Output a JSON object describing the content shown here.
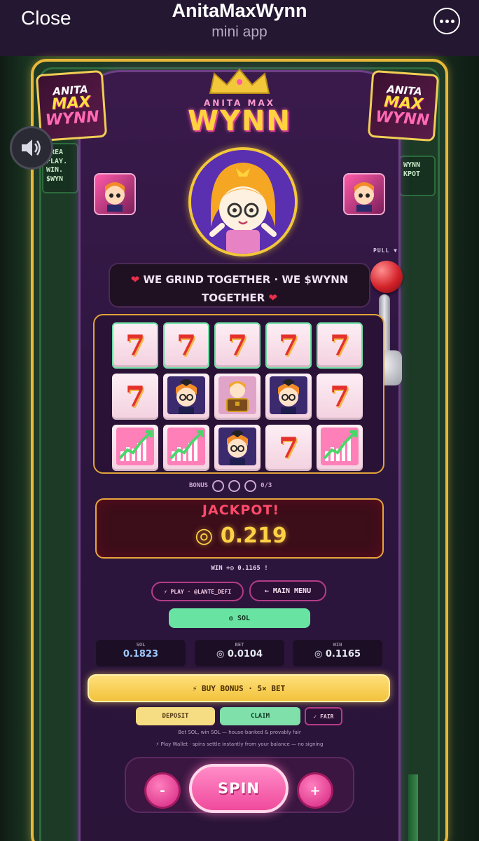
{
  "topbar": {
    "close_label": "Close",
    "title": "AnitaMaxWynn",
    "subtitle": "mini app"
  },
  "logo": {
    "line1": "ANITA MAX",
    "line2": "WYNN",
    "corner_l1": "ANITA",
    "corner_l2": "MAX",
    "corner_l3": "WYNN"
  },
  "side_left": "DREA PLAY. WIN. $WYN",
  "side_right": "WYNN KPOT",
  "pull_label": "PULL ▼",
  "motto": "WE GRIND TOGETHER · WE $WYNN TOGETHER",
  "reels": [
    [
      "7",
      "7",
      "7",
      "7",
      "7"
    ],
    [
      "7",
      "mascot",
      "chest",
      "mascot",
      "7"
    ],
    [
      "chart",
      "chart",
      "mascot",
      "7",
      "chart"
    ]
  ],
  "bonus": {
    "label": "BONUS",
    "progress": "0/3"
  },
  "jackpot": {
    "title": "JACKPOT!",
    "value": "0.219"
  },
  "win_line": "WIN +◎ 0.1165 !",
  "buttons": {
    "play": "⚡ PLAY · @LANTE_DEFI",
    "main_menu": "← MAIN MENU",
    "currency": "◎ SOL",
    "buy_bonus": "⚡ BUY BONUS · 5× BET",
    "deposit": "DEPOSIT",
    "claim": "CLAIM",
    "fair": "✓ FAIR",
    "minus": "-",
    "spin": "SPIN",
    "plus": "+"
  },
  "stats": [
    {
      "label": "SOL",
      "value": "0.1823"
    },
    {
      "label": "BET",
      "value": "◎ 0.0104"
    },
    {
      "label": "WIN",
      "value": "◎ 0.1165"
    }
  ],
  "fine_print": {
    "line1": "Bet SOL, win SOL — house-banked & provably fair",
    "line2": "⚡ Play Wallet · spins settle instantly from your balance — no signing"
  },
  "colors": {
    "accent_gold": "#e9b838",
    "accent_pink": "#f04a9c",
    "accent_green": "#69e3a2",
    "machine_purple": "#2e1640"
  }
}
